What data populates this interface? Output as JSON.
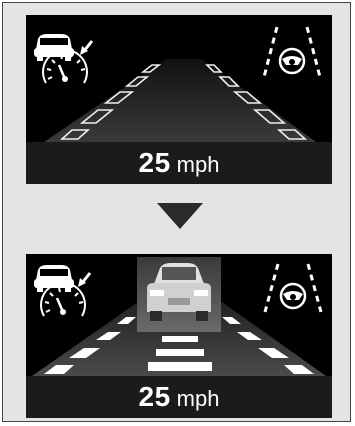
{
  "top_panel": {
    "icons": {
      "left": "acc-car-speedometer-icon",
      "right": "lane-keeping-steering-icon"
    },
    "road": "road-lanes-dim",
    "speed": {
      "value": "25",
      "unit": "mph"
    }
  },
  "transition": {
    "icon": "down-triangle-icon"
  },
  "bottom_panel": {
    "icons": {
      "left": "acc-car-speedometer-icon",
      "right": "lane-keeping-steering-icon",
      "vehicle": "vehicle-ahead-icon"
    },
    "road": "road-lanes-highlighted",
    "speed": {
      "value": "25",
      "unit": "mph"
    }
  }
}
